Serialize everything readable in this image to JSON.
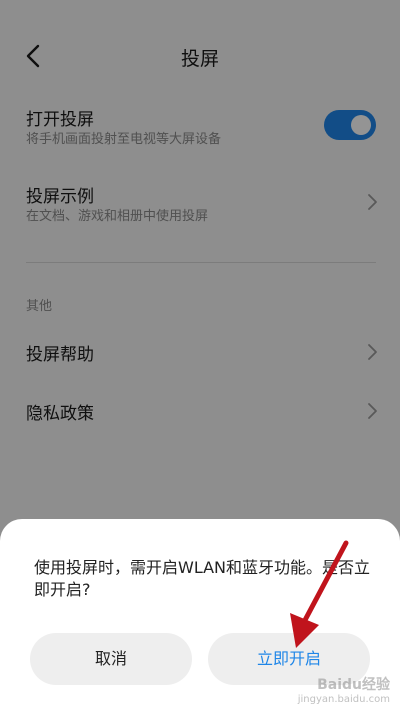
{
  "header": {
    "title": "投屏"
  },
  "settings": {
    "cast_toggle": {
      "title": "打开投屏",
      "subtitle": "将手机画面投射至电视等大屏设备",
      "enabled": true
    },
    "cast_example": {
      "title": "投屏示例",
      "subtitle": "在文档、游戏和相册中使用投屏"
    },
    "section_other": "其他",
    "cast_help": "投屏帮助",
    "privacy_policy": "隐私政策"
  },
  "dialog": {
    "message": "使用投屏时，需开启WLAN和蓝牙功能。是否立即开启?",
    "cancel_label": "取消",
    "confirm_label": "立即开启"
  },
  "watermark": {
    "brand": "Baidu经验",
    "url": "jingyan.baidu.com"
  },
  "colors": {
    "accent": "#1f86e8",
    "annotation_arrow": "#c0141c"
  },
  "icons": {
    "back": "back-arrow-icon",
    "chevron": "chevron-right-icon"
  }
}
